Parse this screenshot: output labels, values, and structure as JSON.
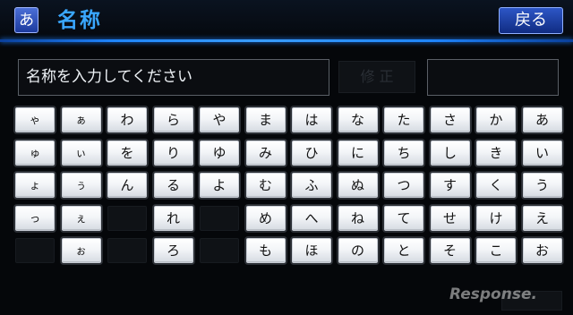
{
  "header": {
    "mode_icon_label": "あ",
    "title": "名称",
    "back_label": "戻る"
  },
  "input": {
    "value": "名称を入力してください"
  },
  "fix_label": "修 正",
  "keyboard": {
    "rows": [
      [
        "ゃ",
        "ぁ",
        "わ",
        "ら",
        "や",
        "ま",
        "は",
        "な",
        "た",
        "さ",
        "か",
        "あ"
      ],
      [
        "ゅ",
        "ぃ",
        "を",
        "り",
        "ゆ",
        "み",
        "ひ",
        "に",
        "ち",
        "し",
        "き",
        "い"
      ],
      [
        "ょ",
        "ぅ",
        "ん",
        "る",
        "よ",
        "む",
        "ふ",
        "ぬ",
        "つ",
        "す",
        "く",
        "う"
      ],
      [
        "っ",
        "ぇ",
        "",
        "れ",
        "",
        "め",
        "へ",
        "ね",
        "て",
        "せ",
        "け",
        "え"
      ],
      [
        "",
        "ぉ",
        "",
        "ろ",
        "",
        "も",
        "ほ",
        "の",
        "と",
        "そ",
        "こ",
        "お"
      ]
    ]
  },
  "watermark": "Response."
}
